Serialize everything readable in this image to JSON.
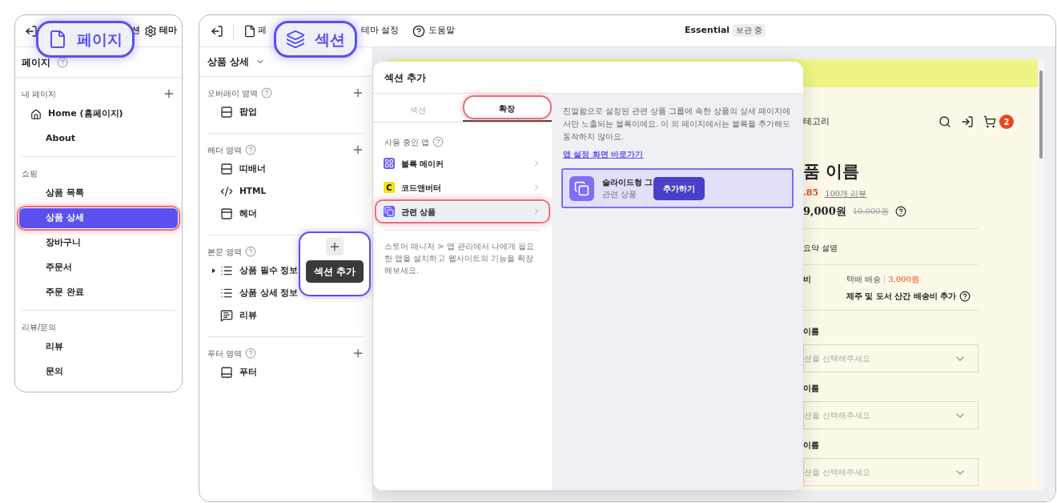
{
  "page_panel": {
    "cut_label": "션",
    "theme_label": "테마",
    "title": "페이지",
    "groups": [
      {
        "label": "내 페이지",
        "addable": true,
        "items": [
          {
            "label": "Home (홈페이지)",
            "kind": "home",
            "selected": false,
            "highlighted": false
          },
          {
            "label": "About",
            "kind": "plain",
            "selected": false,
            "highlighted": false
          }
        ]
      },
      {
        "label": "쇼핑",
        "addable": false,
        "items": [
          {
            "label": "상품 목록",
            "kind": "plain",
            "selected": false,
            "highlighted": false
          },
          {
            "label": "상품 상세",
            "kind": "plain",
            "selected": true,
            "highlighted": true
          },
          {
            "label": "장바구니",
            "kind": "plain",
            "selected": false,
            "highlighted": false
          },
          {
            "label": "주문서",
            "kind": "plain",
            "selected": false,
            "highlighted": false
          },
          {
            "label": "주문 완료",
            "kind": "plain",
            "selected": false,
            "highlighted": false
          }
        ]
      },
      {
        "label": "리뷰/문의",
        "addable": false,
        "items": [
          {
            "label": "리뷰",
            "kind": "plain",
            "selected": false,
            "highlighted": false
          },
          {
            "label": "문의",
            "kind": "plain",
            "selected": false,
            "highlighted": false
          }
        ]
      }
    ]
  },
  "callouts": [
    {
      "label": "페이지",
      "kind": "file"
    },
    {
      "label": "섹션",
      "kind": "layers"
    }
  ],
  "top_bar": {
    "page_label": "페",
    "theme_settings": "테마 설정",
    "help": "도움말",
    "theme_name": "Essential",
    "theme_status": "보관 중"
  },
  "editor_sidebar": {
    "title": "상품 상세",
    "groups": [
      {
        "label": "오버레이 영역",
        "items": [
          {
            "label": "팝업",
            "kind": "popup",
            "expandable": false
          }
        ]
      },
      {
        "label": "헤더 영역",
        "items": [
          {
            "label": "띠배너",
            "kind": "banner",
            "expandable": false
          },
          {
            "label": "HTML",
            "kind": "code",
            "expandable": false
          },
          {
            "label": "헤더",
            "kind": "header",
            "expandable": false
          }
        ]
      },
      {
        "label": "본문 영역",
        "tooltip": "섹션 추가",
        "items": [
          {
            "label": "상품 필수 정보",
            "kind": "list",
            "expandable": true
          },
          {
            "label": "상품 상세 정보",
            "kind": "list",
            "expandable": false
          },
          {
            "label": "리뷰",
            "kind": "review",
            "expandable": false
          }
        ]
      },
      {
        "label": "푸터 영역",
        "items": [
          {
            "label": "푸터",
            "kind": "footer",
            "expandable": false
          }
        ]
      }
    ]
  },
  "modal": {
    "title": "섹션 추가",
    "tabs": [
      {
        "label": "섹션",
        "selected": false,
        "highlighted": false
      },
      {
        "label": "확장",
        "selected": true,
        "highlighted": true
      }
    ],
    "apps_title": "사용 중인 앱",
    "apps": [
      {
        "label": "블록 메이커",
        "kind": "blocks",
        "selected": false,
        "highlighted": false
      },
      {
        "label": "코드앤버터",
        "kind": "letter",
        "icon_text": "C",
        "selected": false,
        "highlighted": false
      },
      {
        "label": "관련 상품",
        "kind": "related",
        "selected": true,
        "highlighted": true
      }
    ],
    "note": "스토어 매니저 > 앱 관리에서 나에게 필요한 앱을 설치하고 웹사이트의 기능을 확장해보세요.",
    "description": "진열함으로 설정된 관련 상품 그룹에 속한 상품의 상세 페이지에서만 노출되는 블록이에요. 이 외 페이지에서는 블록을 추가해도 동작하지 않아요.",
    "link": "앱 설정 화면 바로가기",
    "blocks": [
      {
        "title": "슬라이드형 그",
        "subtitle": "관련 상품",
        "selected": true,
        "button": "추가하기"
      }
    ]
  },
  "preview": {
    "nav_label": "테고리",
    "cart_count": "2",
    "product_title": "품 이름",
    "rating": ".85",
    "reviews": "100개 리뷰",
    "price": "9,000원",
    "original_price": "10,000원",
    "summary": "요약 설명",
    "shipping_label": "비",
    "shipping_method": "택배 배송",
    "shipping_fee": "3,000원",
    "shipping_extra": "제주 및 도서 산간 배송비 추가",
    "options": [
      {
        "label": "이름",
        "placeholder": "션을 선택해주세요"
      },
      {
        "label": "이름",
        "placeholder": "션을 선택해주세요"
      },
      {
        "label": "이름",
        "placeholder": "션을 선택해주세요"
      }
    ]
  }
}
